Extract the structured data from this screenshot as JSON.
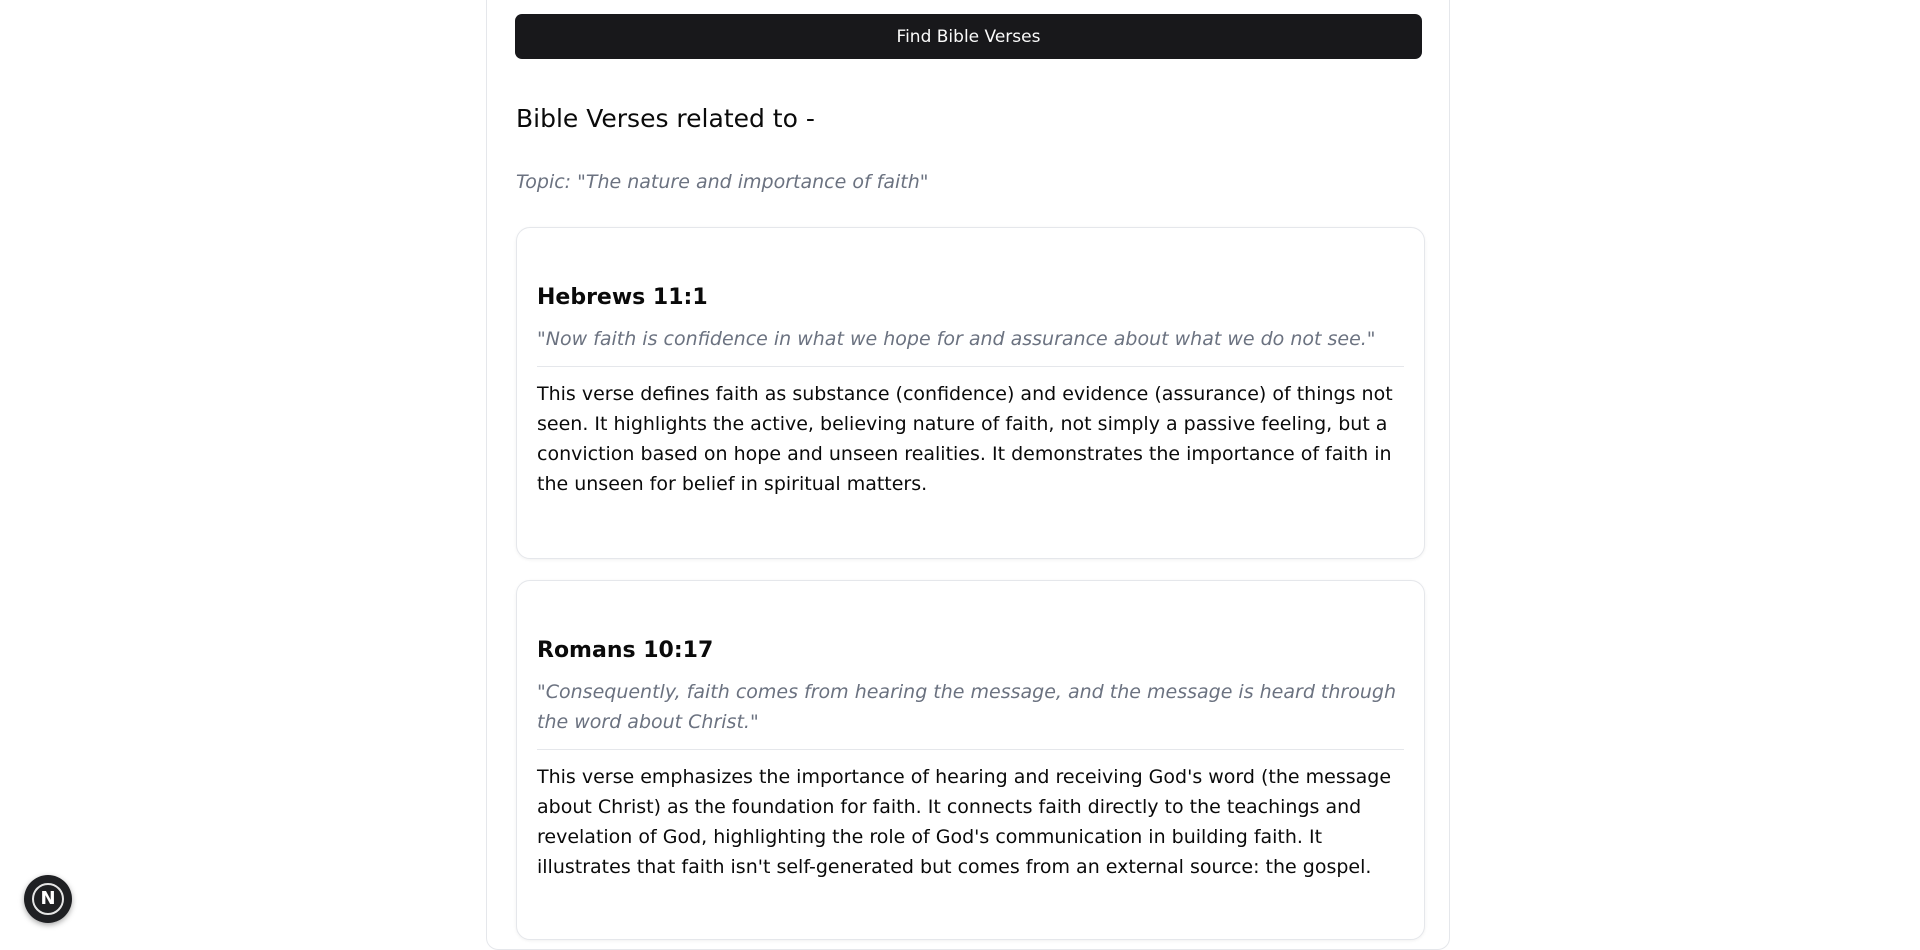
{
  "actions": {
    "find_button_label": "Find Bible Verses"
  },
  "results": {
    "heading": "Bible Verses related to -",
    "topic": "Topic: \"The nature and importance of faith\"",
    "verses": [
      {
        "reference": "Hebrews 11:1",
        "quote": "\"Now faith is confidence in what we hope for and assurance about what we do not see.\"",
        "explanation": "This verse defines faith as substance (confidence) and evidence (assurance) of things not seen. It highlights the active, believing nature of faith, not simply a passive feeling, but a conviction based on hope and unseen realities. It demonstrates the importance of faith in the unseen for belief in spiritual matters."
      },
      {
        "reference": "Romans 10:17",
        "quote": "\"Consequently, faith comes from hearing the message, and the message is heard through the word about Christ.\"",
        "explanation": "This verse emphasizes the importance of hearing and receiving God's word (the message about Christ) as the foundation for faith. It connects faith directly to the teachings and revelation of God, highlighting the role of God's communication in building faith. It illustrates that faith isn't self-generated but comes from an external source: the gospel."
      }
    ]
  },
  "dev_badge": {
    "letter": "N",
    "icon": "nextjs-logo-icon"
  },
  "colors": {
    "button_bg": "#18181b",
    "button_text": "#fafafa",
    "muted_text": "#6b7280",
    "border": "#e5e7eb",
    "badge_bg": "#1f2023"
  }
}
